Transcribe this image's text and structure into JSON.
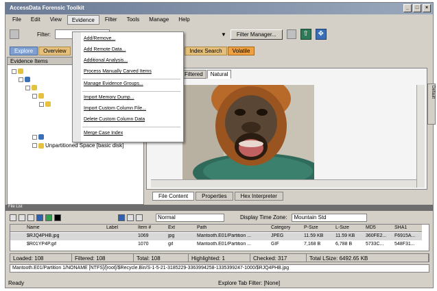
{
  "window": {
    "title": "AccessData Forensic Toolkit"
  },
  "window_buttons": [
    "_",
    "□",
    "×"
  ],
  "menu": [
    "File",
    "Edit",
    "View",
    "Evidence",
    "Filter",
    "Tools",
    "Manage",
    "Help"
  ],
  "toolbar": {
    "filter_label": "Filter:",
    "filter_manager": "Filter Manager...",
    "arrow": "▼"
  },
  "tabs": [
    "Explore",
    "Overview",
    "Index Search",
    "Volatile"
  ],
  "left_pane": {
    "header": "Evidence Items",
    "unassigned": "Unpartitioned Space [basic disk]"
  },
  "evidence_menu": {
    "items": [
      "Add/Remove...",
      "Add Remote Data...",
      "Additional Analysis...",
      "Process Manually Carved Items",
      "Manage Evidence Groups...",
      "Import Memory Dump...",
      "Import Custom Column File...",
      "Delete Custom Column Data",
      "Merge Case Index"
    ]
  },
  "viewer": {
    "tabs": [
      "Filtered",
      "Natural"
    ],
    "bottom_tabs": [
      "File Content",
      "Properties",
      "Hex Interpreter"
    ],
    "side_label": "Default"
  },
  "file_list": {
    "title": "File List",
    "view_mode": "Normal",
    "tz_label": "Display Time Zone:",
    "tz_value": "Mountain Std",
    "columns": [
      "Name",
      "Label",
      "Item #",
      "Ext",
      "Path",
      "Category",
      "P-Size",
      "L-Size",
      "MD5",
      "SHA1"
    ],
    "rows": [
      [
        "$RJQ4PHB.jpg",
        "",
        "1069",
        "jpg",
        "Mantooth.E01/Partition ...",
        "JPEG",
        "11.59 KB",
        "11.59 KB",
        "360FE2...",
        "F6915A..."
      ],
      [
        "$R01YP4P.gif",
        "",
        "1070",
        "gif",
        "Mantooth.E01/Partition ...",
        "GIF",
        "7,168 B",
        "6,788 B",
        "5733C...",
        "548F31..."
      ]
    ]
  },
  "summary": {
    "loaded": "Loaded: 108",
    "filtered": "Filtered: 108",
    "total": "Total: 108",
    "highlighted": "Highlighted: 1",
    "checked": "Checked: 317",
    "total_size": "Total LSize: 6492.65 KB"
  },
  "path_line": "Mantooth.E01/Partition 1/NONAME [NTFS]/[root]/$Recycle.Bin/S-1-5-21-3185229-3363994258-1335399247-1000/$RJQ4PHB.jpg",
  "status": {
    "left": "Ready",
    "right": "Explore Tab Filter: [None]"
  },
  "colors": {
    "title_gradient_start": "#6b7b95",
    "title_gradient_end": "#9aa8bc",
    "tab_first": "#7fa0d0",
    "tab_orange": "#e6c07a",
    "dark_tab": "#f0a040"
  },
  "icons": [
    "up-arrow-icon",
    "cross-arrows-icon",
    "pencil-icon",
    "checkbox-icon",
    "folder-icon",
    "image-icon"
  ]
}
